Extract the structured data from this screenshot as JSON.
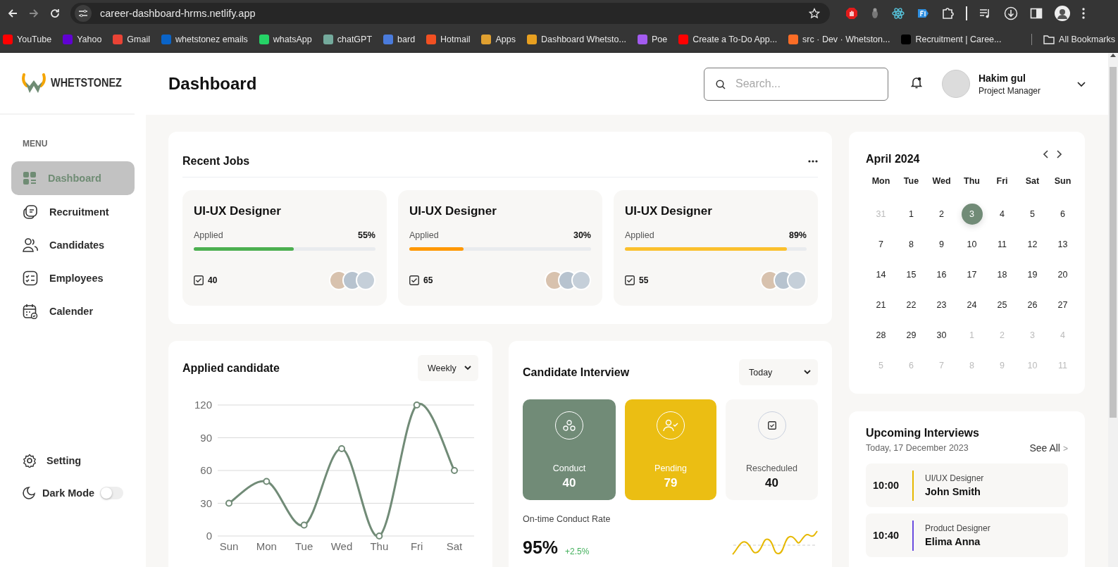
{
  "browser": {
    "url": "career-dashboard-hrms.netlify.app",
    "bookmarks": [
      {
        "label": "YouTube",
        "color": "#ff0000"
      },
      {
        "label": "Yahoo",
        "color": "#6001d2"
      },
      {
        "label": "Gmail",
        "color": "#ea4335"
      },
      {
        "label": "whetstonez emails",
        "color": "#0a64c8"
      },
      {
        "label": "whatsApp",
        "color": "#25d366"
      },
      {
        "label": "chatGPT",
        "color": "#74aa9c"
      },
      {
        "label": "bard",
        "color": "#4a7bdc"
      },
      {
        "label": "Hotmail",
        "color": "#f25022"
      },
      {
        "label": "Apps",
        "color": "#e0a030"
      },
      {
        "label": "Dashboard Whetsto...",
        "color": "#e8a020"
      },
      {
        "label": "Poe",
        "color": "#a35bf0"
      },
      {
        "label": "Create a To-Do App...",
        "color": "#ff0000"
      },
      {
        "label": "src · Dev · Whetston...",
        "color": "#fc6d26"
      },
      {
        "label": "Recruitment | Caree...",
        "color": "#000000"
      }
    ],
    "all_bookmarks": "All Bookmarks"
  },
  "sidebar": {
    "logo": "WHETSTONEZ",
    "menu_heading": "MENU",
    "items": [
      {
        "label": "Dashboard",
        "kind": "dashboard",
        "selected": true
      },
      {
        "label": "Recruitment",
        "kind": "recruitment",
        "selected": false
      },
      {
        "label": "Candidates",
        "kind": "candidates",
        "selected": false
      },
      {
        "label": "Employees",
        "kind": "employees",
        "selected": false
      },
      {
        "label": "Calender",
        "kind": "calendar",
        "selected": false
      }
    ],
    "setting": "Setting",
    "dark_mode": {
      "label": "Dark Mode",
      "on": false
    }
  },
  "header": {
    "title": "Dashboard",
    "search": {
      "placeholder": "Search..."
    },
    "user": {
      "name": "Hakim gul",
      "role": "Project Manager"
    }
  },
  "recent_jobs": {
    "title": "Recent Jobs",
    "jobs": [
      {
        "title": "UI-UX Designer",
        "label": "Applied",
        "percent": "55%",
        "level": 0.55,
        "color": "#4caf50",
        "count": "40"
      },
      {
        "title": "UI-UX Designer",
        "label": "Applied",
        "percent": "30%",
        "level": 0.3,
        "color": "#ff9800",
        "count": "65"
      },
      {
        "title": "UI-UX Designer",
        "label": "Applied",
        "percent": "89%",
        "level": 0.89,
        "color": "#fbc02d",
        "count": "55"
      }
    ]
  },
  "applied_candidate": {
    "title": "Applied candidate",
    "period": "Weekly",
    "chart_data": {
      "type": "line",
      "categories": [
        "Sun",
        "Mon",
        "Tue",
        "Wed",
        "Thu",
        "Fri",
        "Sat"
      ],
      "ylim": [
        0,
        120
      ],
      "yticks": [
        0,
        30,
        60,
        90,
        120
      ],
      "series": [
        {
          "color": "#718b77",
          "marker": true,
          "values": [
            30,
            50,
            10,
            80,
            0,
            120,
            60
          ]
        }
      ],
      "grid": true
    }
  },
  "candidate_interview": {
    "title": "Candidate Interview",
    "period": "Today",
    "stats": [
      {
        "kind": "conduct",
        "label": "Conduct",
        "value": "40",
        "color": "#718b77"
      },
      {
        "kind": "pending",
        "label": "Pending",
        "value": "79",
        "color": "#ebbe13"
      },
      {
        "kind": "rescheduled",
        "label": "Rescheduled",
        "value": "40",
        "color": "#f8f7f5"
      }
    ],
    "rate_label": "On-time Conduct Rate",
    "rate": "95%",
    "change": "+2.5%"
  },
  "calendar": {
    "title": "April 2024",
    "weekdays": [
      "Mon",
      "Tue",
      "Wed",
      "Thu",
      "Fri",
      "Sat",
      "Sun"
    ],
    "weeks": [
      [
        {
          "day": "31",
          "muted": true,
          "selected": false
        },
        {
          "day": "1",
          "muted": false,
          "selected": false
        },
        {
          "day": "2",
          "muted": false,
          "selected": false
        },
        {
          "day": "3",
          "muted": false,
          "selected": true
        },
        {
          "day": "4",
          "muted": false,
          "selected": false
        },
        {
          "day": "5",
          "muted": false,
          "selected": false
        },
        {
          "day": "6",
          "muted": false,
          "selected": false
        }
      ],
      [
        {
          "day": "7",
          "muted": false,
          "selected": false
        },
        {
          "day": "8",
          "muted": false,
          "selected": false
        },
        {
          "day": "9",
          "muted": false,
          "selected": false
        },
        {
          "day": "10",
          "muted": false,
          "selected": false
        },
        {
          "day": "11",
          "muted": false,
          "selected": false
        },
        {
          "day": "12",
          "muted": false,
          "selected": false
        },
        {
          "day": "13",
          "muted": false,
          "selected": false
        }
      ],
      [
        {
          "day": "14",
          "muted": false,
          "selected": false
        },
        {
          "day": "15",
          "muted": false,
          "selected": false
        },
        {
          "day": "16",
          "muted": false,
          "selected": false
        },
        {
          "day": "17",
          "muted": false,
          "selected": false
        },
        {
          "day": "18",
          "muted": false,
          "selected": false
        },
        {
          "day": "19",
          "muted": false,
          "selected": false
        },
        {
          "day": "20",
          "muted": false,
          "selected": false
        }
      ],
      [
        {
          "day": "21",
          "muted": false,
          "selected": false
        },
        {
          "day": "22",
          "muted": false,
          "selected": false
        },
        {
          "day": "23",
          "muted": false,
          "selected": false
        },
        {
          "day": "24",
          "muted": false,
          "selected": false
        },
        {
          "day": "25",
          "muted": false,
          "selected": false
        },
        {
          "day": "26",
          "muted": false,
          "selected": false
        },
        {
          "day": "27",
          "muted": false,
          "selected": false
        }
      ],
      [
        {
          "day": "28",
          "muted": false,
          "selected": false
        },
        {
          "day": "29",
          "muted": false,
          "selected": false
        },
        {
          "day": "30",
          "muted": false,
          "selected": false
        },
        {
          "day": "1",
          "muted": true,
          "selected": false
        },
        {
          "day": "2",
          "muted": true,
          "selected": false
        },
        {
          "day": "3",
          "muted": true,
          "selected": false
        },
        {
          "day": "4",
          "muted": true,
          "selected": false
        }
      ],
      [
        {
          "day": "5",
          "muted": true,
          "selected": false
        },
        {
          "day": "6",
          "muted": true,
          "selected": false
        },
        {
          "day": "7",
          "muted": true,
          "selected": false
        },
        {
          "day": "8",
          "muted": true,
          "selected": false
        },
        {
          "day": "9",
          "muted": true,
          "selected": false
        },
        {
          "day": "10",
          "muted": true,
          "selected": false
        },
        {
          "day": "11",
          "muted": true,
          "selected": false
        }
      ]
    ]
  },
  "upcoming": {
    "title": "Upcoming Interviews",
    "date": "Today, 17 December 2023",
    "see_all": "See All",
    "see_all_arrow": ">",
    "items": [
      {
        "time": "10:00",
        "role": "UI/UX Designer",
        "name": "John Smith",
        "color": "#e6b800"
      },
      {
        "time": "10:40",
        "role": "Product Designer",
        "name": "Elima Anna",
        "color": "#6a4ce0"
      }
    ]
  }
}
